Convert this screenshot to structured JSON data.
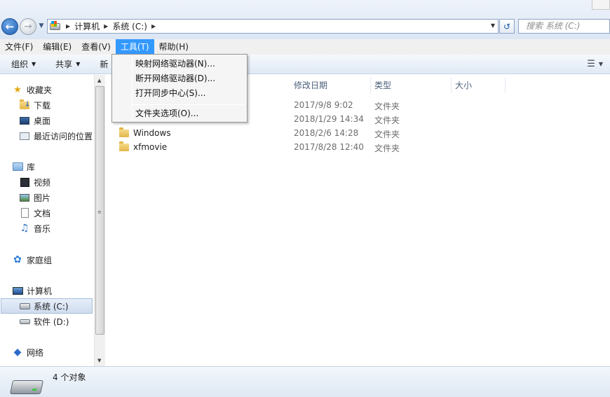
{
  "address": {
    "crumbs": [
      "计算机",
      "系统 (C:)"
    ],
    "search_placeholder": "搜索 系统 (C:)"
  },
  "menubar": {
    "items": [
      "文件(F)",
      "编辑(E)",
      "查看(V)",
      "工具(T)",
      "帮助(H)"
    ],
    "active": "工具(T)"
  },
  "toolbar": {
    "organize": "组织",
    "share": "共享",
    "new": "新"
  },
  "sidebar": {
    "favorites": "收藏夹",
    "downloads": "下载",
    "desktop": "桌面",
    "recent": "最近访问的位置",
    "libraries": "库",
    "videos": "视频",
    "pictures": "图片",
    "documents": "文档",
    "music": "音乐",
    "homegroup": "家庭组",
    "computer": "计算机",
    "drive_c": "系统 (C:)",
    "drive_d": "软件 (D:)",
    "network": "网络"
  },
  "columns": {
    "date": "修改日期",
    "type": "类型",
    "size": "大小"
  },
  "files": [
    {
      "name": "",
      "date": "2017/9/8 9:02",
      "type": "文件夹"
    },
    {
      "name": "",
      "date": "2018/1/29 14:34",
      "type": "文件夹"
    },
    {
      "name": "Windows",
      "date": "2018/2/6 14:28",
      "type": "文件夹"
    },
    {
      "name": "xfmovie",
      "date": "2017/8/28 12:40",
      "type": "文件夹"
    }
  ],
  "tools_menu": {
    "map_drive": "映射网络驱动器(N)...",
    "disconnect_drive": "断开网络驱动器(D)...",
    "sync_center": "打开同步中心(S)...",
    "folder_options": "文件夹选项(O)..."
  },
  "status": {
    "count": "4 个对象"
  }
}
